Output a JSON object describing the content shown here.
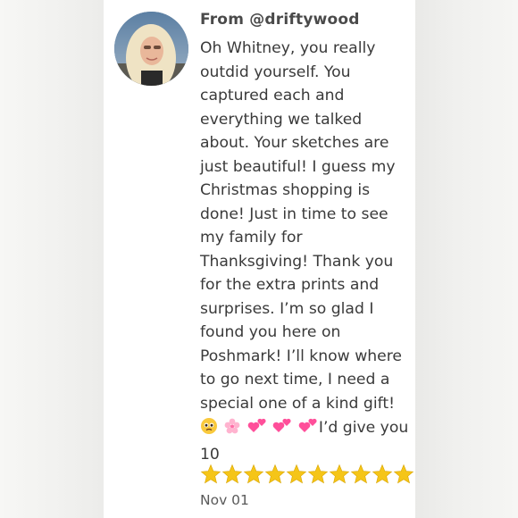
{
  "review": {
    "author_label": "From @driftywood",
    "message": "Oh Whitney, you really outdid yourself. You captured each and everything we talked about. Your sketches are just beautiful! I guess my Christmas shopping is done! Just in time to see my family for Thanksgiving! Thank you for the extra prints and surprises. I’m so glad I found you here on Poshmark! I’ll know where to go next time, I need a special one of a kind gift!",
    "emoji_icons": [
      "pleading-face-icon",
      "cherry-blossom-icon",
      "two-hearts-icon",
      "two-hearts-icon",
      "two-hearts-icon"
    ],
    "emoji_tail_text": "I’d give you",
    "rating_text": "10",
    "stars_shown": 10,
    "date": "Nov 01"
  },
  "colors": {
    "text": "#3a3a3a",
    "star": "#f5c518",
    "heart": "#ff4f9a"
  }
}
